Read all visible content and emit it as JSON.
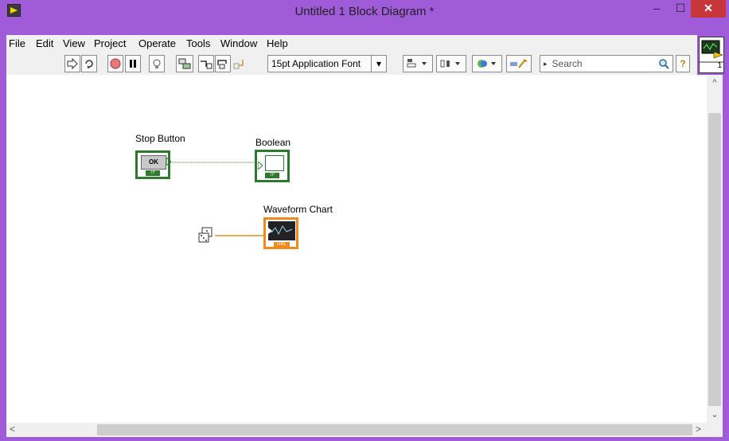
{
  "window": {
    "title": "Untitled 1 Block Diagram *",
    "minimize": "–",
    "maximize": "☐",
    "close": "✕"
  },
  "menu": [
    "File",
    "Edit",
    "View",
    "Project",
    "Operate",
    "Tools",
    "Window",
    "Help"
  ],
  "toolbar": {
    "font": "15pt Application Font",
    "font_arrow": "▾",
    "search_arrow": "▸",
    "search_placeholder": "Search",
    "help": "?"
  },
  "connector_pane_number": "1",
  "scroll": {
    "up": "^",
    "down": "⌄",
    "left": "<",
    "right": ">"
  },
  "diagram": {
    "stop_button": {
      "label": "Stop Button",
      "inner": "OK",
      "type": "TF"
    },
    "boolean": {
      "label": "Boolean",
      "type": "TF"
    },
    "waveform_chart": {
      "label": "Waveform Chart",
      "type": "DBL"
    }
  },
  "colors": {
    "boolean_green": "#2c7a2c",
    "dbl_orange": "#f08a1c",
    "accent_purple": "#a05bd8"
  }
}
